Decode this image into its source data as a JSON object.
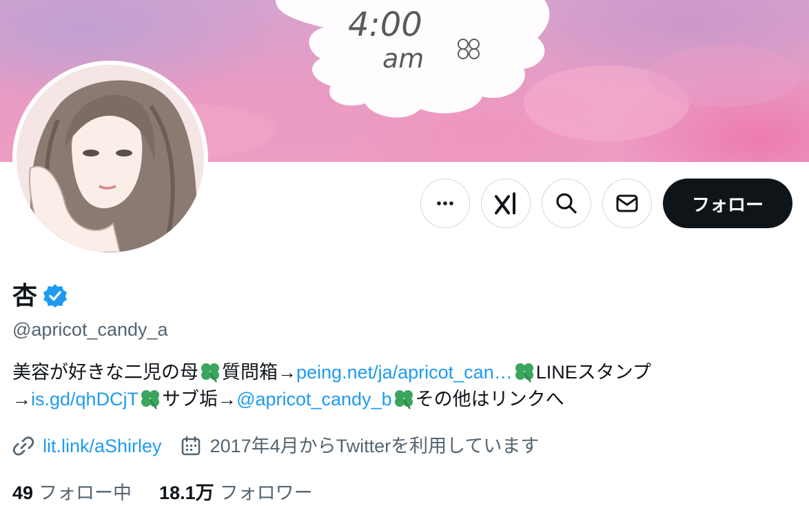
{
  "banner": {
    "text_time": "4:00",
    "text_ampm": "am"
  },
  "actions": {
    "more_icon": "more-horizontal-icon",
    "grok_icon": "grok-icon",
    "search_icon": "search-icon",
    "message_icon": "mail-icon",
    "follow_label": "フォロー"
  },
  "profile": {
    "display_name": "杏",
    "handle": "@apricot_candy_a",
    "verified": true,
    "bio": {
      "part1": "美容が好きな二児の母",
      "part2": "質問箱→",
      "link1": "peing.net/ja/apricot_can…",
      "part3": "LINEスタンプ",
      "part4": "→",
      "link2": "is.gd/qhDCjT",
      "part5": "サブ垢→",
      "link3": "@apricot_candy_b",
      "part6": "その他はリンクへ"
    },
    "website": "lit.link/aShirley",
    "joined": "2017年4月からTwitterを利用しています"
  },
  "stats": {
    "following_count": "49",
    "following_label": "フォロー中",
    "followers_count": "18.1万",
    "followers_label": "フォロワー"
  },
  "colors": {
    "accent": "#1d9bf0",
    "text": "#0f1419",
    "secondary": "#536471",
    "border": "#cfd9de",
    "clover": "#3ba55d"
  }
}
